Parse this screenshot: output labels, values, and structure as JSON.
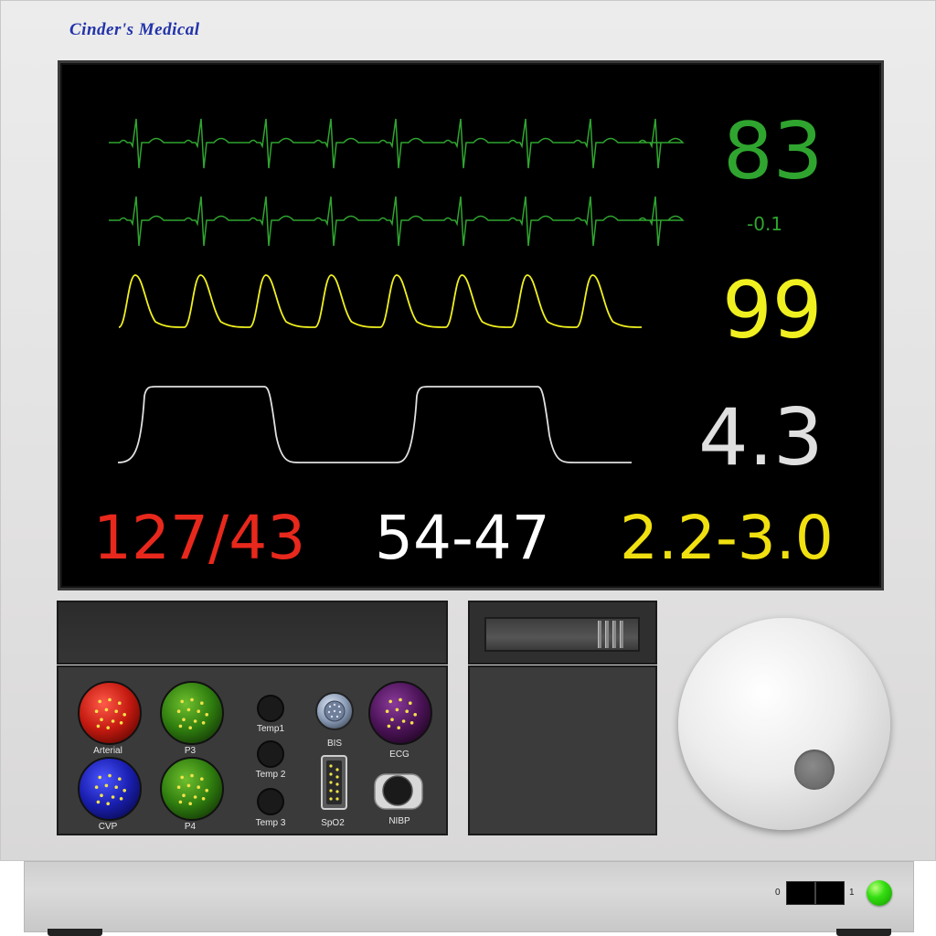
{
  "brand": "Cinder's Medical",
  "vitals": {
    "heart_rate": "83",
    "st_value": "-0.1",
    "spo2": "99",
    "etco2": "4.3",
    "blood_pressure": "127/43",
    "bis_range": "54-47",
    "gas_range": "2.2-3.0"
  },
  "colors": {
    "ecg": "#2fa52f",
    "spo2": "#f0f020",
    "etco2": "#e0e0e0",
    "bp": "#e8281c",
    "bis": "#ffffff",
    "gas": "#f0e010"
  },
  "ports": {
    "arterial": "Arterial",
    "p3": "P3",
    "cvp": "CVP",
    "p4": "P4",
    "temp1": "Temp1",
    "temp2": "Temp 2",
    "temp3": "Temp 3",
    "bis": "BIS",
    "spo2": "SpO2",
    "ecg": "ECG",
    "nibp": "NIBP"
  },
  "power": {
    "off_label": "0",
    "on_label": "1"
  },
  "icons": [
    "connector-icon",
    "power-led-icon",
    "rotary-knob-icon"
  ]
}
